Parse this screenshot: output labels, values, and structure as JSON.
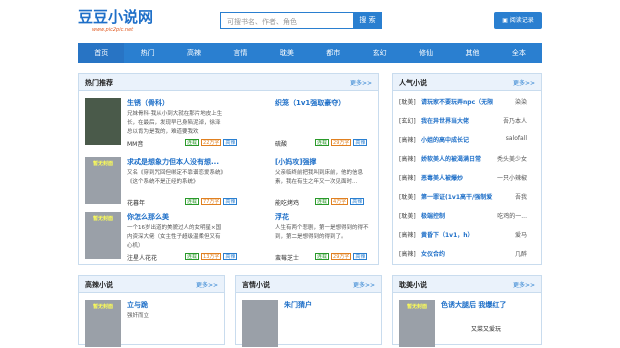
{
  "logo": {
    "title": "豆豆小说网",
    "subtitle": "www.pic2pic.net"
  },
  "search": {
    "placeholder": "可搜书名、作者、角色",
    "button": "搜 索"
  },
  "history_button": "阅读记录",
  "nav": [
    "首页",
    "热门",
    "高辣",
    "言情",
    "耽美",
    "都市",
    "玄幻",
    "修仙",
    "其他",
    "全本"
  ],
  "hot": {
    "title": "热门推荐",
    "more": "更多>>",
    "books": [
      {
        "title": "生锈（骨科）",
        "desc": "兄妹骨科·我从小到大就在那片地皮上生长，在最后，发现早已身陷泥淖，徐泽总以肯为是我的，难道要我欢",
        "author": "MM音",
        "tags": [
          "连载",
          "22万字",
          "高辣"
        ]
      },
      {
        "title": "织笼（1v1强取豪夺）",
        "desc": "",
        "author": "硫酸",
        "tags": [
          "连载",
          "29万字",
          "高辣"
        ]
      },
      {
        "title": "求忒是想象力但本人没有想...",
        "desc": "又名《穿到咒回但绑定不靠谱恋爱系统》《这个系统不是正经的系统》",
        "author": "花暮年",
        "tags": [
          "连载",
          "77万字",
          "高辣"
        ]
      },
      {
        "title": "[小妈攻]强撑",
        "desc": "父亲临终前把我叫到床前，他的信息素，我在有生之年又一次见面时...",
        "author": "能吃烤鸡",
        "tags": [
          "连载",
          "4万字",
          "高辣"
        ]
      },
      {
        "title": "你怎么那么美",
        "desc": "一个16岁出道的美貌过人的女明星×国内资深大佬（女主性子超级温柔但又有心机）",
        "author": "注星人花花",
        "tags": [
          "连载",
          "13万字",
          "高辣"
        ]
      },
      {
        "title": "浮花",
        "desc": "人生有两个悲剧，第一是想得到的得不到，第二是想得到的得到了。",
        "author": "蛮莓芝士",
        "tags": [
          "连载",
          "29万字",
          "高辣"
        ]
      }
    ]
  },
  "popular": {
    "title": "人气小说",
    "more": "更多>>",
    "items": [
      {
        "cat": "[耽美]",
        "title": "请玩家不要玩弄npc（无限）",
        "author": "染染"
      },
      {
        "cat": "[玄幻]",
        "title": "我在异世界当大佬",
        "author": "吾乃本人"
      },
      {
        "cat": "[高辣]",
        "title": "小姐的高中成长记",
        "author": "salofall"
      },
      {
        "cat": "[高辣]",
        "title": "娇软美人的被渴满日常",
        "author": "秃头美少女"
      },
      {
        "cat": "[高辣]",
        "title": "恶毒美人被爆炒",
        "author": "一只小辣椒"
      },
      {
        "cat": "[耽美]",
        "title": "第一罪证(1v1高干/强制爱)",
        "author": "吾我"
      },
      {
        "cat": "[耽美]",
        "title": "极端控制",
        "author": "吃鸡的一..."
      },
      {
        "cat": "[高辣]",
        "title": "黄昏下（1v1，h）",
        "author": "爱马"
      },
      {
        "cat": "[高辣]",
        "title": "女仪合约",
        "author": "几醉"
      }
    ]
  },
  "sections": [
    {
      "title": "高辣小说",
      "more": "更多>>",
      "book": {
        "title": "立与跪",
        "desc": "强奸而立"
      }
    },
    {
      "title": "言情小说",
      "more": "更多>>",
      "book": {
        "title": "朱门猜户",
        "desc": ""
      }
    },
    {
      "title": "耽美小说",
      "more": "更多>>",
      "book": {
        "title": "色诱大腿后 我爆红了",
        "desc": "",
        "author": "又菜又爱玩"
      }
    }
  ],
  "cover_label": "暂无封面",
  "colors": {
    "primary": "#2a7fd0",
    "title": "#1e6fc8",
    "accent": "#e05a20"
  }
}
